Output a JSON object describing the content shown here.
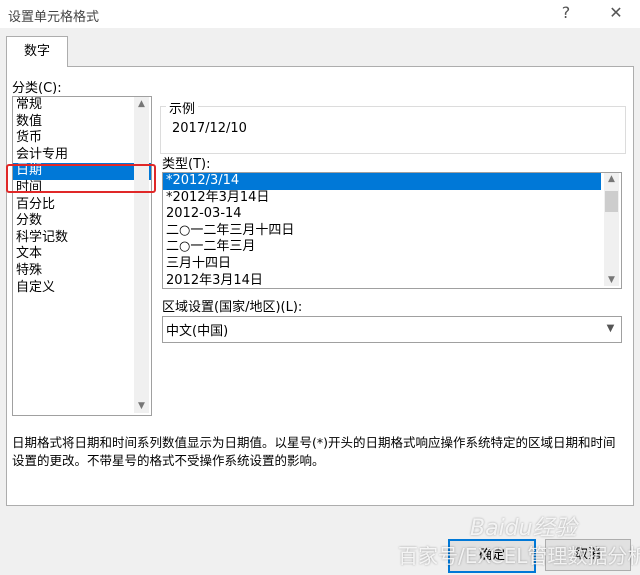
{
  "window": {
    "title": "设置单元格格式",
    "help": "?",
    "close": "✕"
  },
  "tabs": [
    {
      "label": "数字"
    }
  ],
  "category": {
    "label": "分类(C):",
    "items": [
      "常规",
      "数值",
      "货币",
      "会计专用",
      "日期",
      "时间",
      "百分比",
      "分数",
      "科学记数",
      "文本",
      "特殊",
      "自定义"
    ],
    "selected": "日期"
  },
  "sample": {
    "label": "示例",
    "value": "2017/12/10"
  },
  "type": {
    "label": "类型(T):",
    "items": [
      "*2012/3/14",
      "*2012年3月14日",
      "2012-03-14",
      "二○一二年三月十四日",
      "二○一二年三月",
      "三月十四日",
      "2012年3月14日"
    ],
    "selected": "*2012/3/14"
  },
  "locale": {
    "label": "区域设置(国家/地区)(L):",
    "value": "中文(中国)"
  },
  "description": "日期格式将日期和时间系列数值显示为日期值。以星号(*)开头的日期格式响应操作系统特定的区域日期和时间设置的更改。不带星号的格式不受操作系统设置的影响。",
  "buttons": {
    "ok": "确定",
    "cancel": "取消"
  },
  "watermark": {
    "line1": "百家号/EXCEL管理数据分析",
    "line2": "Baidu经验"
  },
  "colors": {
    "selection": "#0078d7",
    "highlight": "#e02828"
  }
}
